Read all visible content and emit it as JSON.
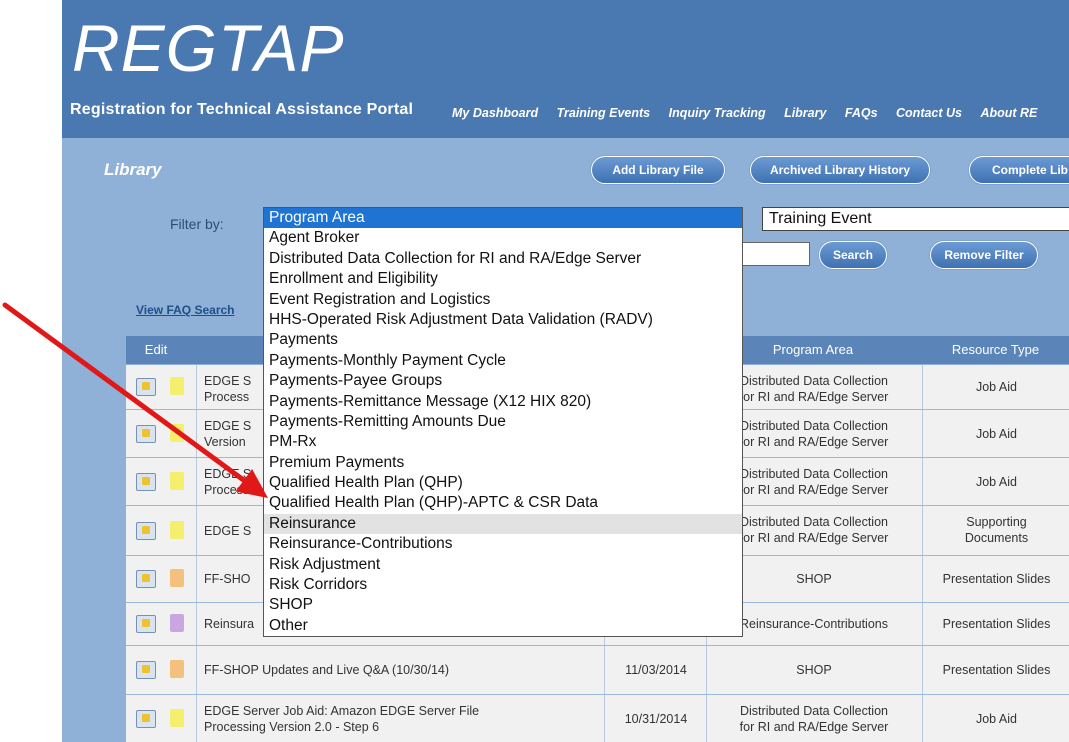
{
  "brand": {
    "logo": "REGTAP",
    "subtitle": "Registration for Technical Assistance Portal"
  },
  "nav": [
    "My Dashboard",
    "Training Events",
    "Inquiry Tracking",
    "Library",
    "FAQs",
    "Contact Us",
    "About RE"
  ],
  "library": {
    "title": "Library",
    "add_button": "Add Library File",
    "archived_button": "Archived Library History",
    "complete_button": "Complete Lib"
  },
  "filter": {
    "label": "Filter by:",
    "selected": "Program Area",
    "options": [
      "Program Area",
      "Agent Broker",
      "Distributed Data Collection for RI and RA/Edge Server",
      "Enrollment and Eligibility",
      "Event Registration and Logistics",
      "HHS-Operated Risk Adjustment Data Validation (RADV)",
      "Payments",
      "Payments-Monthly Payment Cycle",
      "Payments-Payee Groups",
      "Payments-Remittance Message (X12 HIX 820)",
      "Payments-Remitting Amounts Due",
      "PM-Rx",
      "Premium Payments",
      "Qualified Health Plan (QHP)",
      "Qualified Health Plan (QHP)-APTC & CSR Data",
      "Reinsurance",
      "Reinsurance-Contributions",
      "Risk Adjustment",
      "Risk Corridors",
      "SHOP",
      "Other"
    ],
    "hovered": "Reinsurance",
    "secondary_value": "Training Event",
    "search_button": "Search",
    "remove_button": "Remove Filter"
  },
  "faq_link": "View FAQ Search",
  "table": {
    "headers": {
      "edit": "Edit",
      "program_area": "Program Area",
      "resource_type": "Resource Type"
    },
    "rows": [
      {
        "title1": "EDGE S",
        "title2": "Process",
        "date": "",
        "program1": "Distributed Data Collection",
        "program2": "for RI and RA/Edge Server",
        "type1": "Job Aid",
        "type2": "",
        "icon": "#f5ef6e"
      },
      {
        "title1": "EDGE S",
        "title2": "Version",
        "date": "",
        "program1": "Distributed Data Collection",
        "program2": "for RI and RA/Edge Server",
        "type1": "Job Aid",
        "type2": "",
        "icon": "#f5ef6e"
      },
      {
        "title1": "EDGE S",
        "title2": "Process",
        "date": "",
        "program1": "Distributed Data Collection",
        "program2": "for RI and RA/Edge Server",
        "type1": "Job Aid",
        "type2": "",
        "icon": "#f5ef6e"
      },
      {
        "title1": "EDGE S",
        "title2": "",
        "date": "",
        "program1": "Distributed Data Collection",
        "program2": "for RI and RA/Edge Server",
        "type1": "Supporting",
        "type2": "Documents",
        "icon": "#f5ef6e"
      },
      {
        "title1": "FF-SHO",
        "title2": "",
        "date": "",
        "program1": "SHOP",
        "program2": "",
        "type1": "Presentation Slides",
        "type2": "",
        "icon": "#f3c07e"
      },
      {
        "title1": "Reinsura",
        "title2": "",
        "date": "",
        "program1": "Reinsurance-Contributions",
        "program2": "",
        "type1": "Presentation Slides",
        "type2": "",
        "icon": "#c9a6e0"
      },
      {
        "title1": "FF-SHOP Updates and Live Q&A (10/30/14)",
        "title2": "",
        "date": "11/03/2014",
        "program1": "SHOP",
        "program2": "",
        "type1": "Presentation Slides",
        "type2": "",
        "icon": "#f3c07e"
      },
      {
        "title1": "EDGE Server Job Aid: Amazon EDGE Server File",
        "title2": "Processing Version 2.0 - Step 6",
        "date": "10/31/2014",
        "program1": "Distributed Data Collection",
        "program2": "for RI and RA/Edge Server",
        "type1": "Job Aid",
        "type2": "",
        "icon": "#f5ef6e"
      }
    ]
  },
  "colors": {
    "header": "#4a78b0",
    "content": "#8fb0d7",
    "selected": "#1e73d3",
    "arrow": "#e01818"
  }
}
